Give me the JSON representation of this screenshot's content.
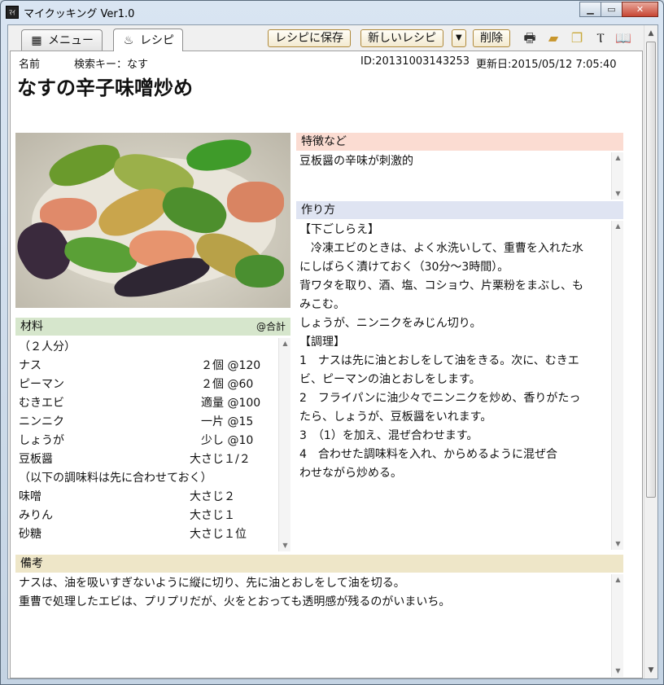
{
  "window": {
    "title": "マイクッキング Ver1.0",
    "app_icon_text": "ﾏｲ",
    "buttons": {
      "minimize": "▁",
      "maximize": "▭",
      "close": "✕"
    }
  },
  "tabs": [
    {
      "label": "メニュー",
      "icon": "menu-list-icon",
      "active": false
    },
    {
      "label": "レシピ",
      "icon": "pot-icon",
      "active": true
    }
  ],
  "toolbar": {
    "save_label": "レシピに保存",
    "new_label": "新しいレシピ",
    "new_dropdown": "▼",
    "delete_label": "削除",
    "icons": [
      "print-icon",
      "open-folder-icon",
      "copy-icon",
      "tools-icon",
      "book-icon"
    ]
  },
  "recipe": {
    "name_label": "名前",
    "search_key": "検索キー：なす",
    "id_text": "ID:20131003143253",
    "updated_text": "更新日:2015/05/12 7:05:40",
    "title": "なすの辛子味噌炒め"
  },
  "features": {
    "header": "特徴など",
    "text": "豆板醤の辛味が刺激的"
  },
  "method": {
    "header": "作り方",
    "lines": [
      "【下ごしらえ】",
      "　冷凍エビのときは、よく水洗いして、重曹を入れた水",
      "にしばらく漬けておく（30分～3時間）。",
      "背ワタを取り、酒、塩、コショウ、片栗粉をまぶし、も",
      "みこむ。",
      "しょうが、ニンニクをみじん切り。",
      "【調理】",
      "1　ナスは先に油とおしをして油をきる。次に、むきエ",
      "ビ、ピーマンの油とおしをします。",
      "2　フライパンに油少々でニンニクを炒め、香りがたっ",
      "たら、しょうが、豆板醤をいれます。",
      "3　（1）を加え、混ぜ合わせます。",
      "4　合わせた調味料を入れ、からめるように混ぜ合",
      "わせながら炒める。"
    ]
  },
  "ingredients": {
    "header": "材料",
    "total_label": "@合計",
    "servings": "（２人分）",
    "items": [
      {
        "name": "ナス",
        "qty": "　２個 @120"
      },
      {
        "name": "ピーマン",
        "qty": "　２個 @60"
      },
      {
        "name": "むきエビ",
        "qty": "　適量 @100"
      },
      {
        "name": "ニンニク",
        "qty": "　一片 @15"
      },
      {
        "name": "しょうが",
        "qty": "　少し @10"
      },
      {
        "name": "豆板醤",
        "qty": "大さじ１/２"
      },
      {
        "name": "（以下の調味料は先に合わせておく）",
        "qty": ""
      },
      {
        "name": "味噌",
        "qty": "大さじ２"
      },
      {
        "name": "みりん",
        "qty": "大さじ１"
      },
      {
        "name": "砂糖",
        "qty": "大さじ１位"
      }
    ]
  },
  "notes": {
    "header": "備考",
    "lines": [
      "ナスは、油を吸いすぎないように縦に切り、先に油とおしをして油を切る。",
      "重曹で処理したエビは、プリプリだが、火をとおっても透明感が残るのがいまいち。"
    ]
  },
  "colors": {
    "features_header": "#fbdcd2",
    "method_header": "#dfe4f2",
    "ingredients_header": "#d6e6cc",
    "notes_header": "#eee6c8"
  }
}
